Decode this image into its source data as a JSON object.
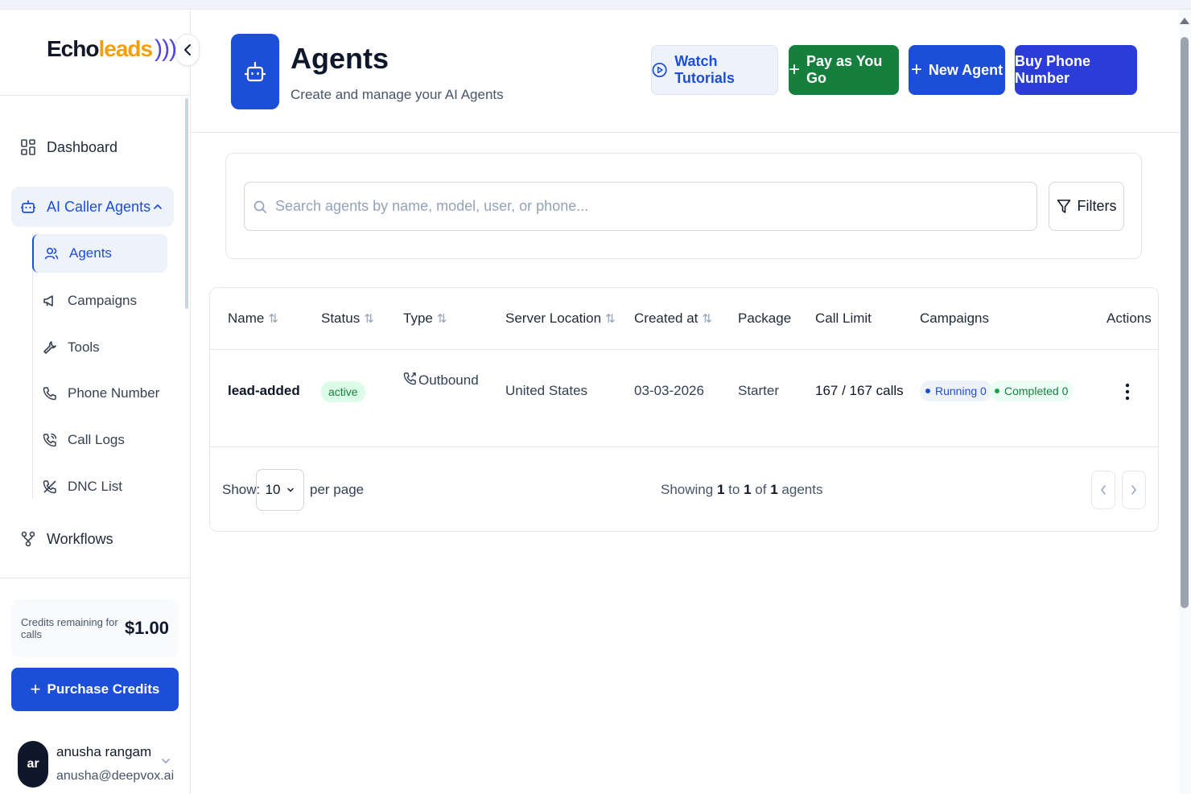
{
  "brand": {
    "name_part1": "Echo",
    "name_part2": "leads",
    "waves": ")))"
  },
  "sidebar": {
    "items": [
      {
        "label": "Dashboard",
        "icon": "dashboard-grid-icon"
      },
      {
        "label": "AI Caller Agents",
        "icon": "robot-icon",
        "expanded": true
      },
      {
        "label": "Workflows",
        "icon": "workflow-icon"
      }
    ],
    "sub_items": [
      {
        "label": "Agents",
        "icon": "users-icon",
        "active": true
      },
      {
        "label": "Campaigns",
        "icon": "megaphone-icon"
      },
      {
        "label": "Tools",
        "icon": "wrench-icon"
      },
      {
        "label": "Phone Number",
        "icon": "phone-icon"
      },
      {
        "label": "Call Logs",
        "icon": "phone-call-icon"
      },
      {
        "label": "DNC List",
        "icon": "phone-off-icon"
      }
    ],
    "credits_label": "Credits remaining for calls",
    "credits_value": "$1.00",
    "purchase_label": "Purchase Credits",
    "user": {
      "initials": "ar",
      "name": "anusha rangam",
      "email": "anusha@deepvox.ai"
    }
  },
  "header": {
    "title": "Agents",
    "subtitle": "Create and manage your AI Agents",
    "buttons": {
      "tutorials": "Watch Tutorials",
      "pay_as_you_go": "Pay as You Go",
      "new_agent": "New Agent",
      "buy_number": "Buy Phone Number"
    }
  },
  "search": {
    "placeholder": "Search agents by name, model, user, or phone...",
    "value": "",
    "filters_label": "Filters"
  },
  "table": {
    "columns": [
      "Name",
      "Status",
      "Type",
      "Server Location",
      "Created at",
      "Package",
      "Call Limit",
      "Campaigns",
      "Actions"
    ],
    "sortable": [
      true,
      true,
      true,
      true,
      true,
      false,
      false,
      false,
      false
    ],
    "rows": [
      {
        "name": "lead-added",
        "status": "active",
        "type": "Outbound",
        "server_location": "United States",
        "created_at": "03-03-2026",
        "package": "Starter",
        "call_limit": "167 / 167 calls",
        "campaigns_running": "Running 0",
        "campaigns_completed": "Completed 0"
      }
    ]
  },
  "pagination": {
    "show_label": "Show:",
    "per_page_value": "10",
    "per_page_label": "per page",
    "showing_prefix": "Showing",
    "from": "1",
    "to_word": "to",
    "to": "1",
    "of_word": "of",
    "total": "1",
    "suffix": "agents"
  },
  "colors": {
    "primary": "#1d4ed8",
    "success": "#15803d",
    "buy_button": "#2c3cd8",
    "logo_accent": "#f59e0b"
  }
}
